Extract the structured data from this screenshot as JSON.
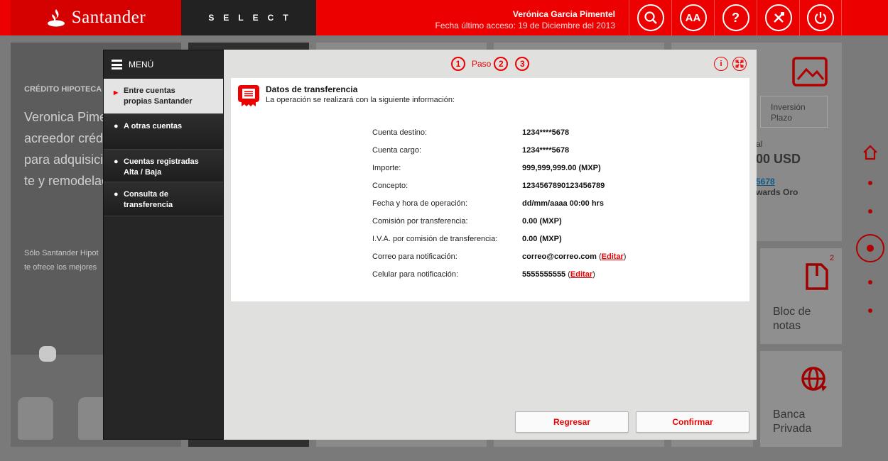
{
  "header": {
    "brand": "Santander",
    "product": "SELECT",
    "user_name": "Verónica Garcia Pimentel",
    "last_access": "Fecha último acceso: 19 de Diciembre del 2013",
    "font_button_label": "AA",
    "help_button_label": "?",
    "icons": [
      "search-icon",
      "font-size-icon",
      "help-icon",
      "tools-icon",
      "power-icon"
    ]
  },
  "background": {
    "promo_label": "CRÉDITO HIPOTECA",
    "promo_text": "Veronica Pimentel eres acreedor crédito hipotec para adquisici sustitución, te y remodelació",
    "promo_small_line1": "Sólo Santander Hipot",
    "promo_small_line2": "te ofrece los mejores",
    "inversion_label": "Inversión Plazo",
    "balance_label": "al",
    "balance_value": "00 USD",
    "account_link": "5678",
    "card_name": "wards Oro",
    "notes_badge": "2",
    "notes_label": "Bloc de notas",
    "private_label": "Banca Privada"
  },
  "menu": {
    "title": "MENÚ",
    "items": [
      {
        "label": "Entre cuentas propias Santander",
        "bullet": "▶"
      },
      {
        "label": "A otras cuentas",
        "bullet": "●"
      },
      {
        "label": "Cuentas registradas Alta / Baja",
        "bullet": "●"
      },
      {
        "label": "Consulta de transferencia",
        "bullet": "●"
      }
    ]
  },
  "steps": {
    "label": "Paso",
    "numbers": [
      "1",
      "2",
      "3"
    ]
  },
  "modal_controls": {
    "info": "i",
    "close_icon": "close-icon"
  },
  "transfer": {
    "title": "Datos de transferencia",
    "subtitle": "La operación se realizará con la siguiente información:",
    "rows": [
      {
        "label": "Cuenta destino:",
        "value": "1234****5678"
      },
      {
        "label": "Cuenta cargo:",
        "value": "1234****5678"
      },
      {
        "label": "Importe:",
        "value": "999,999,999.00 (MXP)"
      },
      {
        "label": "Concepto:",
        "value": "1234567890123456789"
      },
      {
        "label": "Fecha y hora de operación:",
        "value": "dd/mm/aaaa 00:00 hrs"
      },
      {
        "label": "Comisión por transferencia:",
        "value": "0.00 (MXP)"
      },
      {
        "label": "I.V.A. por comisión de transferencia:",
        "value": "0.00 (MXP)"
      },
      {
        "label": "Correo para notificación:",
        "value": "correo@correo.com",
        "edit": "Editar"
      },
      {
        "label": "Celular para notificación:",
        "value": "5555555555",
        "edit": "Editar"
      }
    ]
  },
  "buttons": {
    "back": "Regresar",
    "confirm": "Confirmar"
  },
  "colors": {
    "brand_red": "#ec0000",
    "menu_dark": "#262626",
    "modal_bg": "#e0e0df"
  }
}
